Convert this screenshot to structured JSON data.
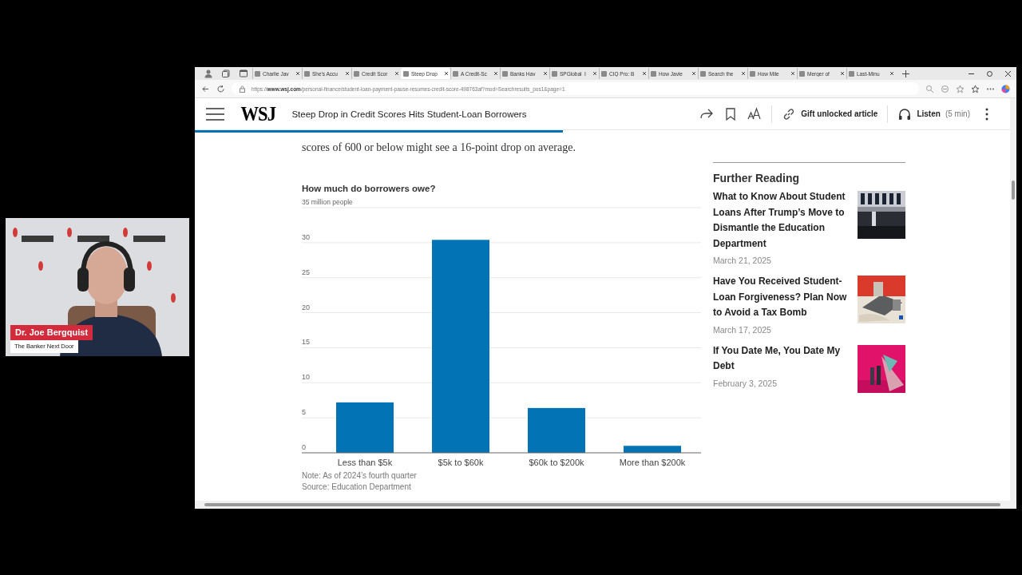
{
  "browser": {
    "tabs": [
      {
        "title": "Charlie Jav",
        "selected": false
      },
      {
        "title": "She's Accu",
        "selected": false
      },
      {
        "title": "Credit Scor",
        "selected": false
      },
      {
        "title": "Steep Drop",
        "selected": true
      },
      {
        "title": "A Credit-Sc",
        "selected": false
      },
      {
        "title": "Banks Hav",
        "selected": false
      },
      {
        "title": "SPGlobal_I",
        "selected": false
      },
      {
        "title": "CIQ Pro: B",
        "selected": false
      },
      {
        "title": "How Javie",
        "selected": false
      },
      {
        "title": "Search the",
        "selected": false
      },
      {
        "title": "How Mile",
        "selected": false
      },
      {
        "title": "Merger of",
        "selected": false
      },
      {
        "title": "Last-Minu",
        "selected": false
      }
    ],
    "url": "https://www.wsj.com/personal-finance/student-loan-payment-pause-resumes-credit-score-498763af?mod=Searchresults_pos1&page=1",
    "header": {
      "logo": "WSJ",
      "headline": "Steep Drop in Credit Scores Hits Student-Loan Borrowers",
      "gift": "Gift unlocked article",
      "listen": "Listen",
      "listen_duration": "(5 min)",
      "reading_progress": {
        "level": 0.45
      }
    }
  },
  "article": {
    "paragraph": "scores of 600 or below might see a 16-point drop on average.",
    "chart": {
      "chart_data": {
        "type": "bar",
        "title": "How much do borrowers owe?",
        "categories": [
          "Less than $5k",
          "$5k to $60k",
          "$60k to $200k",
          "More than $200k"
        ],
        "values": [
          7.2,
          30.4,
          6.4,
          1.0
        ],
        "ylim": [
          0,
          35
        ],
        "grid": true,
        "yticks": [
          0,
          5,
          10,
          15,
          20,
          25,
          30,
          {
            "value": 35,
            "label": "35 million people"
          }
        ]
      },
      "note": "Note: As of 2024’s fourth quarter",
      "source": "Source: Education Department"
    }
  },
  "further_reading": {
    "heading": "Further Reading",
    "items": [
      {
        "title": "What to Know About Student Loans After Trump’s Move to Dismantle the Education Department",
        "date": "March 21, 2025",
        "kind": "picture"
      },
      {
        "title": "Have You Received Student-Loan Forgiveness? Plan Now to Avoid a Tax Bomb",
        "date": "March 17, 2025",
        "kind": "picture"
      },
      {
        "title": "If You Date Me, You Date My Debt",
        "date": "February 3, 2025",
        "kind": "picture"
      }
    ]
  },
  "webcam": {
    "name": "Dr. Joe Bergquist",
    "show": "The Banker Next Door"
  }
}
